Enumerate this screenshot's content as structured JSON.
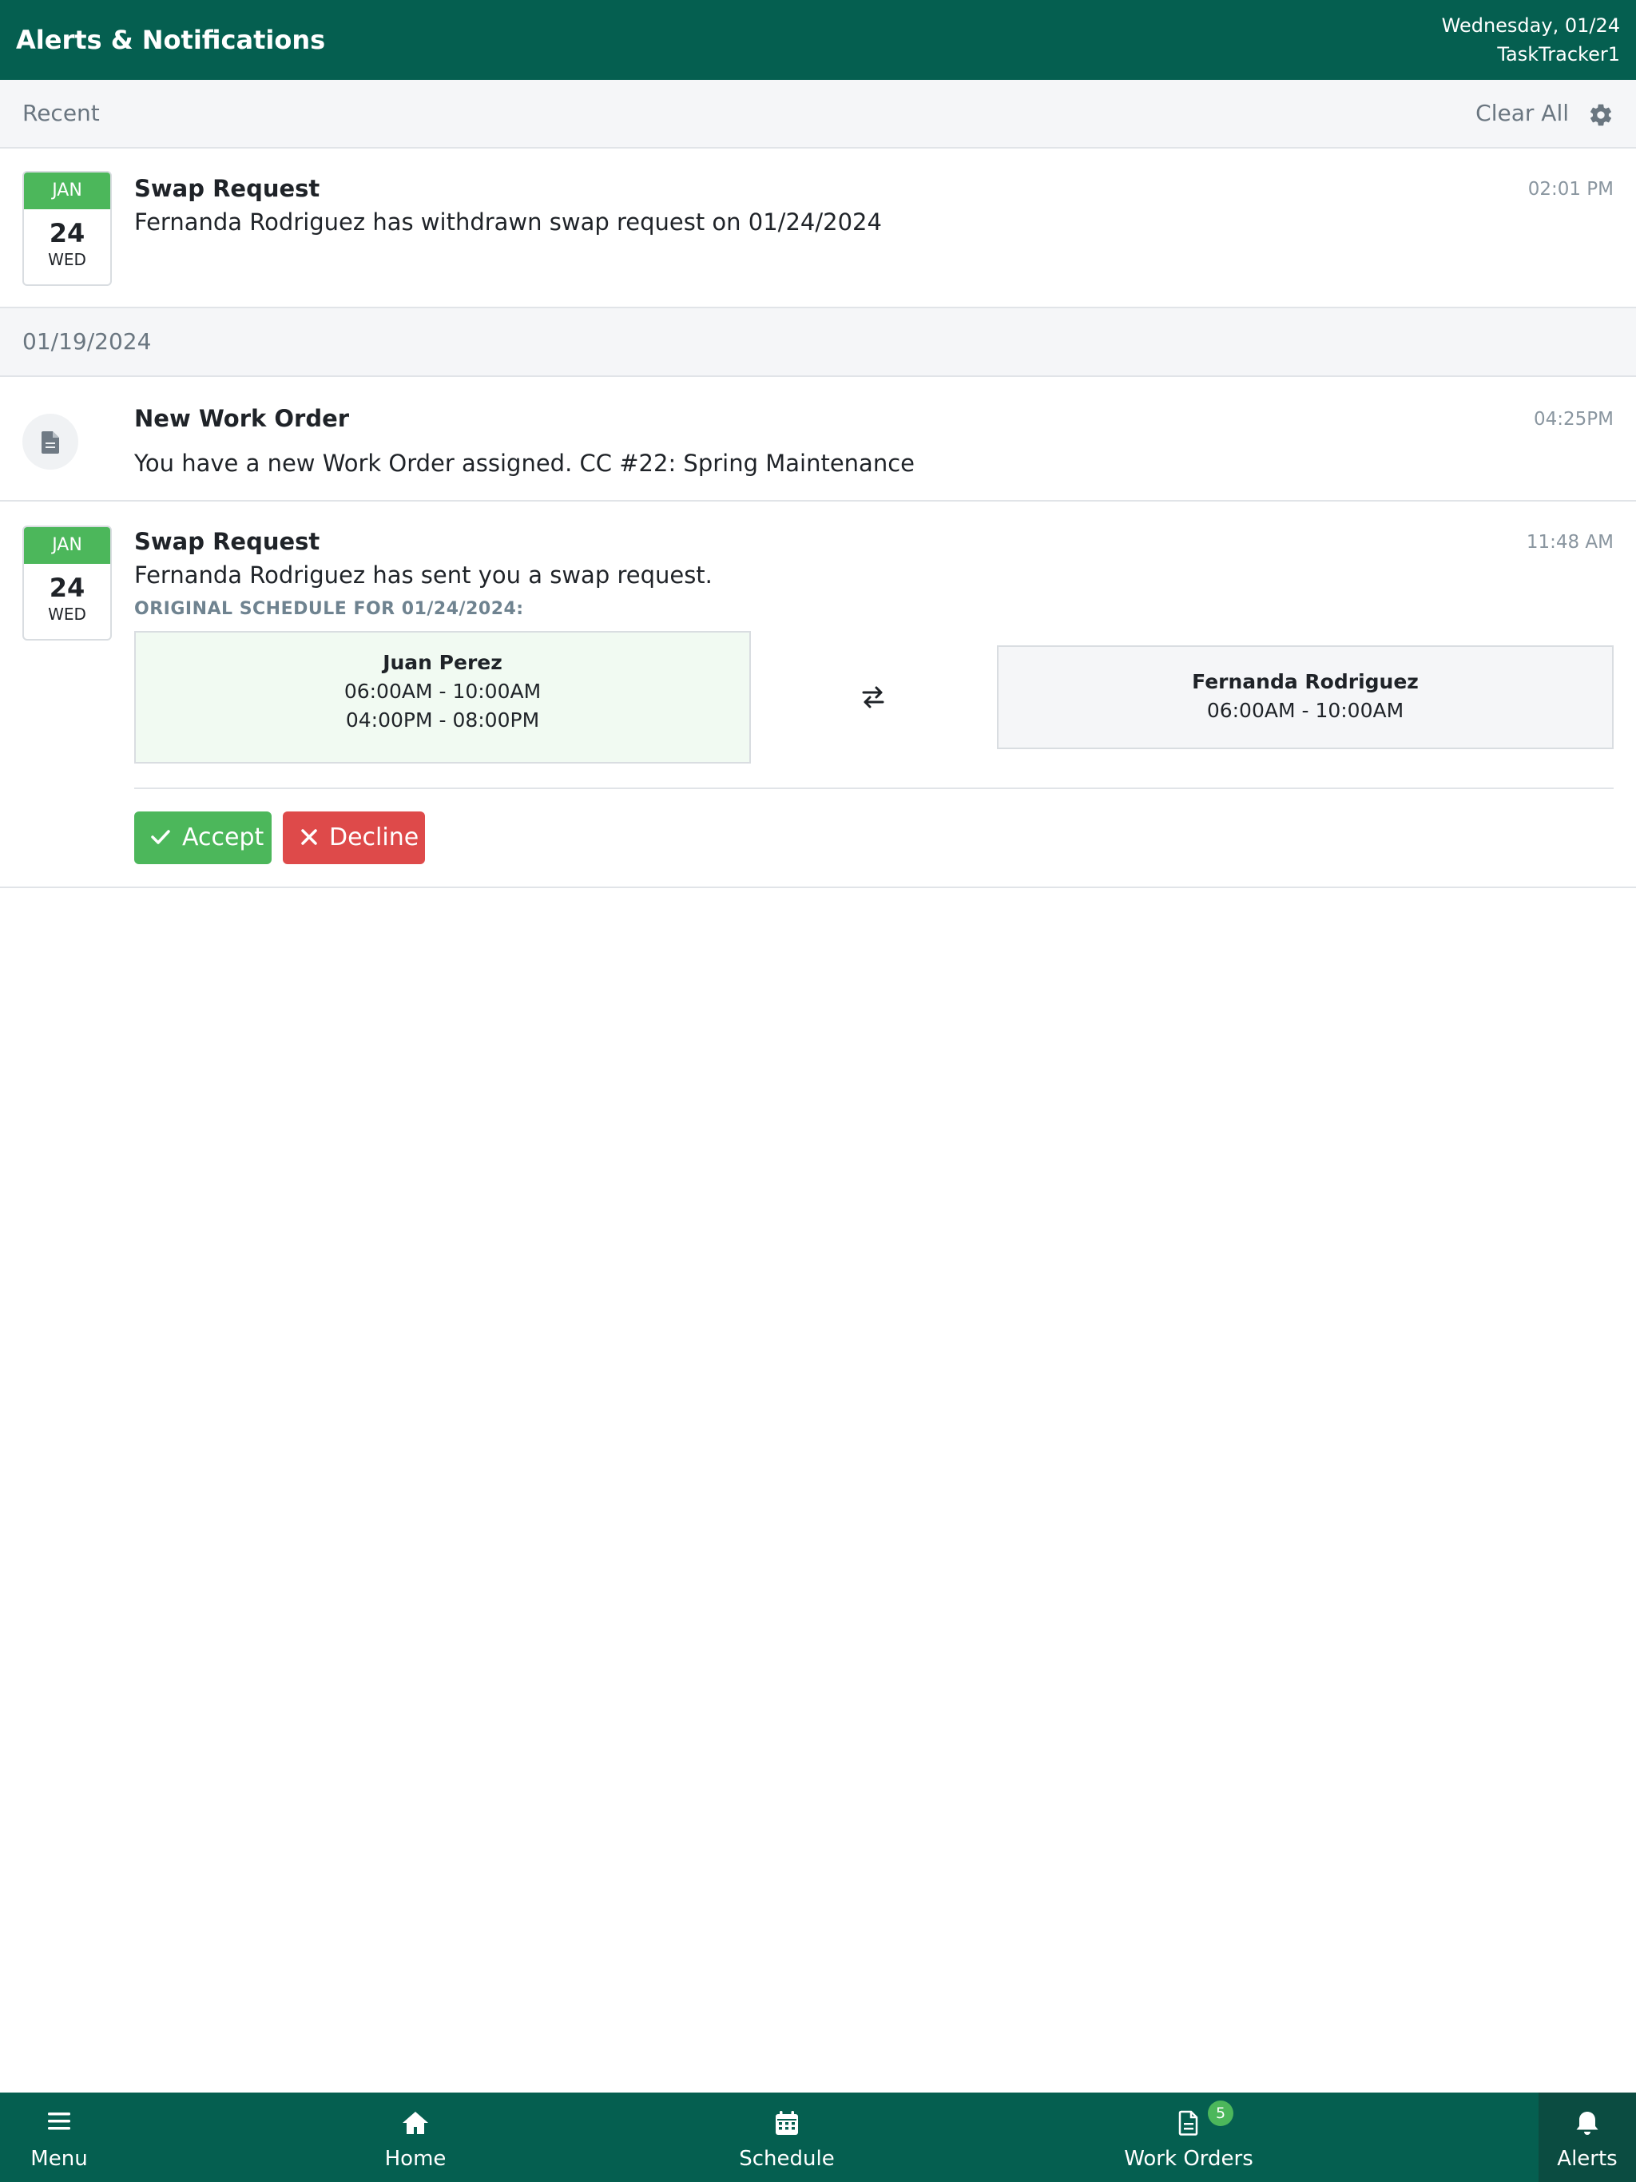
{
  "header": {
    "title": "Alerts & Notifications",
    "date": "Wednesday, 01/24",
    "app_name": "TaskTracker1"
  },
  "recent_section": {
    "label": "Recent",
    "clear_all_label": "Clear All",
    "settings_icon": "gear-icon"
  },
  "notifications_recent": [
    {
      "calendar": {
        "month": "JAN",
        "day": "24",
        "weekday": "WED"
      },
      "title": "Swap Request",
      "text": "Fernanda Rodriguez has withdrawn swap request on 01/24/2024",
      "time": "02:01 PM"
    }
  ],
  "date_section": {
    "label": "01/19/2024"
  },
  "work_order": {
    "icon": "document-icon",
    "title": "New Work Order",
    "text": "You have a new Work Order assigned. CC #22: Spring Maintenance",
    "time": "04:25PM"
  },
  "swap_request": {
    "calendar": {
      "month": "JAN",
      "day": "24",
      "weekday": "WED"
    },
    "title": "Swap Request",
    "text": "Fernanda Rodriguez has sent you a swap request.",
    "time": "11:48 AM",
    "schedule_label": "ORIGINAL SCHEDULE FOR 01/24/2024:",
    "original": {
      "name": "Juan Perez",
      "shifts": [
        "06:00AM - 10:00AM",
        "04:00PM - 08:00PM"
      ]
    },
    "requested": {
      "name": "Fernanda Rodriguez",
      "shifts": [
        "06:00AM - 10:00AM"
      ]
    },
    "swap_icon": "swap-arrows-icon",
    "accept_label": "Accept",
    "decline_label": "Decline"
  },
  "colors": {
    "header_bg": "#055f50",
    "accent_green": "#4cb75b",
    "decline_red": "#de4a4a",
    "original_box_bg": "#f1faf2",
    "requested_box_bg": "#f5f6f8"
  },
  "bottom_nav": {
    "items": [
      {
        "label": "Menu",
        "icon": "menu-icon"
      },
      {
        "label": "Home",
        "icon": "home-icon"
      },
      {
        "label": "Schedule",
        "icon": "calendar-icon"
      },
      {
        "label": "Work Orders",
        "icon": "document-icon",
        "badge": "5"
      },
      {
        "label": "Alerts",
        "icon": "bell-icon",
        "active": true
      }
    ]
  }
}
